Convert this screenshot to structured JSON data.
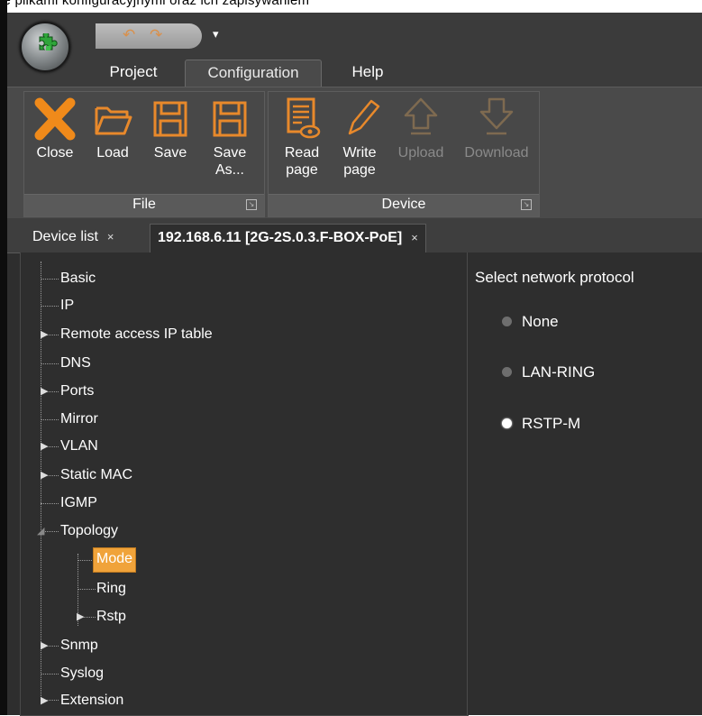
{
  "caption_strip": "ie plikami konfiguracyjnymi oraz ich zapisywaniem",
  "qat": {
    "undo_icon": "undo-icon",
    "redo_icon": "redo-icon",
    "dropdown_icon": "qat-dropdown-icon"
  },
  "ribbon_tabs": [
    "Project",
    "Configuration",
    "Help"
  ],
  "active_ribbon_tab": "Configuration",
  "groups": {
    "file": {
      "name": "File",
      "buttons": [
        {
          "label_line1": "Close",
          "label_line2": "",
          "icon": "close-icon"
        },
        {
          "label_line1": "Load",
          "label_line2": "",
          "icon": "folder-icon"
        },
        {
          "label_line1": "Save",
          "label_line2": "",
          "icon": "save-icon"
        },
        {
          "label_line1": "Save",
          "label_line2": "As...",
          "icon": "save-as-icon"
        }
      ]
    },
    "device": {
      "name": "Device",
      "buttons": [
        {
          "label_line1": "Read",
          "label_line2": "page",
          "icon": "read-page-icon",
          "enabled": true
        },
        {
          "label_line1": "Write",
          "label_line2": "page",
          "icon": "write-page-icon",
          "enabled": true
        },
        {
          "label_line1": "Upload",
          "label_line2": "",
          "icon": "upload-icon",
          "enabled": false
        },
        {
          "label_line1": "Download",
          "label_line2": "",
          "icon": "download-icon",
          "enabled": false
        }
      ]
    }
  },
  "doc_tabs": [
    {
      "label": "Device list",
      "close": "×"
    },
    {
      "label": "192.168.6.11 [2G-2S.0.3.F-BOX-PoE]",
      "close": "×"
    }
  ],
  "tree": [
    {
      "label": "Basic",
      "expandable": false
    },
    {
      "label": "IP",
      "expandable": false
    },
    {
      "label": "Remote access IP table",
      "expandable": true
    },
    {
      "label": "DNS",
      "expandable": false
    },
    {
      "label": "Ports",
      "expandable": true
    },
    {
      "label": "Mirror",
      "expandable": false
    },
    {
      "label": "VLAN",
      "expandable": true
    },
    {
      "label": "Static MAC",
      "expandable": true
    },
    {
      "label": "IGMP",
      "expandable": false
    },
    {
      "label": "Topology",
      "expanded": true,
      "children": [
        {
          "label": "Mode",
          "selected": true
        },
        {
          "label": "Ring"
        },
        {
          "label": "Rstp",
          "expandable": true
        }
      ]
    },
    {
      "label": "Snmp",
      "expandable": true
    },
    {
      "label": "Syslog",
      "expandable": false
    },
    {
      "label": "Extension",
      "expandable": true
    }
  ],
  "protocol": {
    "title": "Select network protocol",
    "options": [
      "None",
      "LAN-RING",
      "RSTP-M"
    ],
    "selected": "RSTP-M"
  },
  "colors": {
    "accent": "#f0a33a",
    "icon_orange": "#e8892b",
    "background": "#2e2e2e"
  }
}
